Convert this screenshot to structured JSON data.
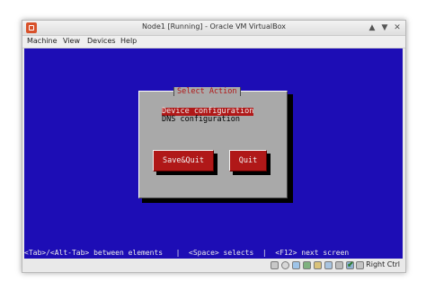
{
  "window": {
    "title": "Node1 [Running] - Oracle VM VirtualBox",
    "controls": [
      "▲",
      "▼",
      "✕"
    ]
  },
  "menu": [
    "Machine",
    "View",
    "Devices",
    "Help"
  ],
  "dialog": {
    "title": "Select Action",
    "options": [
      "Device configuration",
      "DNS configuration"
    ],
    "selected_index": 0,
    "buttons": [
      "Save&Quit",
      "Quit"
    ]
  },
  "helpbar": "<Tab>/<Alt-Tab> between elements   |  <Space> selects  |  <F12> next screen",
  "status": {
    "icons": [
      "hard-disk-icon",
      "optical-drive-icon",
      "usb-icon",
      "network-icon",
      "shared-folder-icon",
      "display-icon",
      "video-capture-icon",
      "cpu-icon",
      "mouse-integration-icon",
      "keyboard-icon"
    ],
    "host_key_label": "Right Ctrl"
  },
  "colors": {
    "vm_background": "#1d0db5",
    "dialog_gray": "#a9a9a9",
    "accent_red": "#b01818"
  }
}
